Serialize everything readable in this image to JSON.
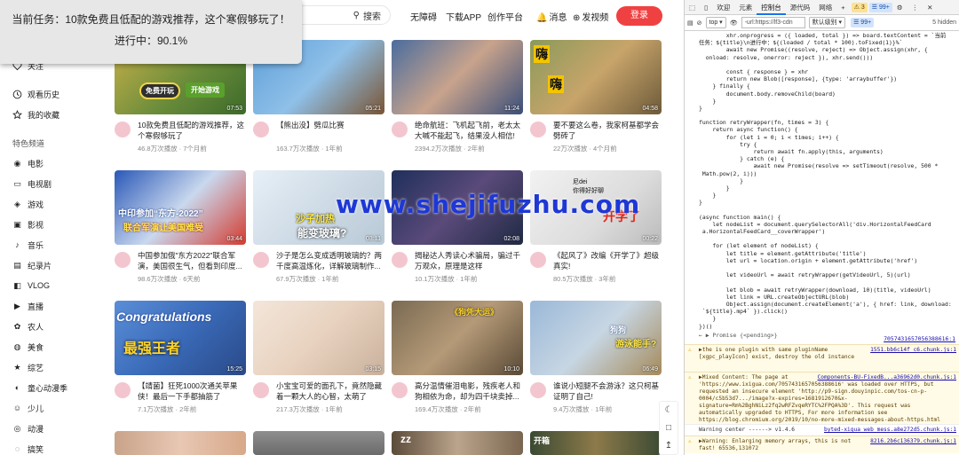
{
  "toast": {
    "title": "当前任务：10款免费且低配的游戏推荐，这个寒假够玩了！",
    "progress_text": "进行中：90.1%",
    "progress": 0.901
  },
  "header": {
    "search_label": "搜索",
    "links": [
      "无障碍",
      "下载APP",
      "创作平台",
      "消息",
      "发视频"
    ],
    "login": "登录"
  },
  "sidebar": {
    "top_items": [
      "关注",
      "观看历史",
      "我的收藏"
    ],
    "section_title": "特色频道",
    "channels": [
      "电影",
      "电视剧",
      "游戏",
      "影视",
      "音乐",
      "纪录片",
      "VLOG",
      "直播",
      "农人",
      "美食",
      "综艺",
      "童心动漫季",
      "少儿",
      "动漫",
      "搞笑"
    ]
  },
  "thumb_texts": {
    "r1c1": [
      "游戏推荐",
      "免费开玩",
      "开始游戏"
    ],
    "r1c4": [
      "嗨",
      "嗨"
    ],
    "r2c1": [
      "中印参加“东方-2022”",
      "联合军演让美国难受"
    ],
    "r2c2": [
      "沙子加热",
      "能变玻璃?"
    ],
    "r2c4": [
      "尼dei",
      "你得好好聊",
      "开学了"
    ],
    "r3c1": [
      "Congratulations",
      "最强王者"
    ],
    "r3c3": [
      "《狗凭大运》"
    ],
    "r3c4": [
      "狗狗",
      "游泳能手?"
    ],
    "r4c3": [
      "zz"
    ],
    "r4c4": [
      "开箱"
    ]
  },
  "videos": [
    {
      "title": "10款免费且低配的游戏推荐，这个寒假够玩了",
      "stats": "46.8万次播放 · 7个月前",
      "duration": "07:53"
    },
    {
      "title": "【熊出没】劈瓜比赛",
      "stats": "163.7万次播放 · 1年前",
      "duration": "05:21"
    },
    {
      "title": "绝命航班：飞机起飞前，老太太大喊不能起飞，结果没人相信!",
      "stats": "2394.2万次播放 · 2年前",
      "duration": "11:24"
    },
    {
      "title": "要不要这么卷，我家柯基都学会劈砖了",
      "stats": "22万次播放 · 4个月前",
      "duration": "04:58"
    },
    {
      "title": "中国参加俄\"东方2022\"联合军演，美国很生气，但看到印度...",
      "stats": "98.6万次播放 · 6天前",
      "duration": "03:44"
    },
    {
      "title": "沙子是怎么变成透明玻璃的？两千度高温炼化，详解玻璃制作...",
      "stats": "67.9万次播放 · 1年前",
      "duration": "03:11"
    },
    {
      "title": "揭秘达人秀读心术骗局，骗过千万观众，原理是这样",
      "stats": "10.1万次播放 · 1年前",
      "duration": "02:08"
    },
    {
      "title": "《起风了》改编《开学了》超级真实!",
      "stats": "80.5万次播放 · 3年前",
      "duration": "00:22"
    },
    {
      "title": "【靖菌】狂死1000次通关苹果侠！最后一下手都抽筋了",
      "stats": "7.1万次播放 · 2年前",
      "duration": "15:25"
    },
    {
      "title": "小宝宝可爱的面孔下，竟然隐藏着一颗大人的心智，太萌了",
      "stats": "217.3万次播放 · 1年前",
      "duration": "03:15"
    },
    {
      "title": "高分温情催泪电影，残疾老人和狗相依为命，却为四千块卖掉...",
      "stats": "169.4万次播放 · 2年前",
      "duration": "10:10"
    },
    {
      "title": "谁说小短腿不会游泳？这只柯基证明了自己!",
      "stats": "9.4万次播放 · 1年前",
      "duration": "06:49"
    }
  ],
  "watermark": "www.shejifuzhu.com",
  "devtools": {
    "tabs": [
      "欢迎",
      "元素",
      "控制台",
      "源代码",
      "网络"
    ],
    "active_tab": "控制台",
    "badges": {
      "warn": "3",
      "info": "99+"
    },
    "toolbar": {
      "context": "top",
      "filter": "-url:https://lf3-cdn",
      "level": "默认级别",
      "issues": "99+",
      "hidden": "5 hidden"
    },
    "code_lines": [
      "        xhr.onprogress = ({ loaded, total }) => board.textContent = `当前",
      "任务：${title}\\n进行中：${(loaded / total * 100).toFixed(1)}%`",
      "        await new Promise((resolve, reject) => Object.assign(xhr, {",
      "  onload: resolve, onerror: reject }), xhr.send()))",
      "",
      "        const { response } = xhr",
      "        return new Blob([response], {type: 'arraybuffer'})",
      "    } finally {",
      "        document.body.removeChild(board)",
      "    }",
      "}",
      "",
      "function retryWrapper(fn, times = 3) {",
      "    return async function() {",
      "        for (let i = 0; i < times; i++) {",
      "            try {",
      "                return await fn.apply(this, arguments)",
      "            } catch (e) {",
      "                await new Promise(resolve => setTimeout(resolve, 500 *",
      " Math.pow(2, i)))",
      "            }",
      "        }",
      "    }",
      "}",
      "",
      "(async function main() {",
      "    let nodeList = document.querySelectorAll('div.HorizontalFeedCard",
      " a.HorizontalFeedCard__coverWrapper')",
      "",
      "    for (let element of nodeList) {",
      "        let title = element.getAttribute('title')",
      "        let url = location.origin + element.getAttribute('href')",
      "",
      "        let videoUrl = await retryWrapper(getVideoUrl, 5)(url)",
      "",
      "        let blob = await retryWrapper(download, 10)(title, videoUrl)",
      "        let link = URL.createObjectURL(blob)",
      "        Object.assign(document.createElement('a'), { href: link, download:",
      " `${title}.mp4` }).click()",
      "    }",
      "})()",
      "← ▶ Promise {<pending>}"
    ],
    "line_ref": "7057431657056388616:1",
    "messages": [
      {
        "text": "▶the is one plugin with same pluginName [xgpc_playIcon] exist, destroy the old instance",
        "src": "1551.bb6c14f c6.chunk.js:1"
      },
      {
        "text": "▶Mixed Content: The page at 'https://www.ixigua.com/7057431657056388616' was loaded over HTTPS, but requested an insecure element 'http://p9-sign.douyinpic.com/tos-cn-p-0004/c5b53d7.../image?x-expires=1681912670&x-signature=Rm%2BghNiLz2fq2wRFZvqeRYTC%2FPQA%3D'. This request was automatically upgraded to HTTPS, For more information see https://blog.chromium.org/2019/10/no-more-mixed-messages-about-https.html",
        "src": "Components-BU-FixedB...a36962d0.chunk.js:1"
      },
      {
        "text": "Warning center ------> v1.4.6",
        "src": "byted-xigua web_mess.a8e272d5.chunk.js:1"
      },
      {
        "text": "▶Warning: Enlarging memory arrays, this is not fast! 65536,131072",
        "src": "8216.2b6c136379.chunk.js:1"
      }
    ]
  }
}
